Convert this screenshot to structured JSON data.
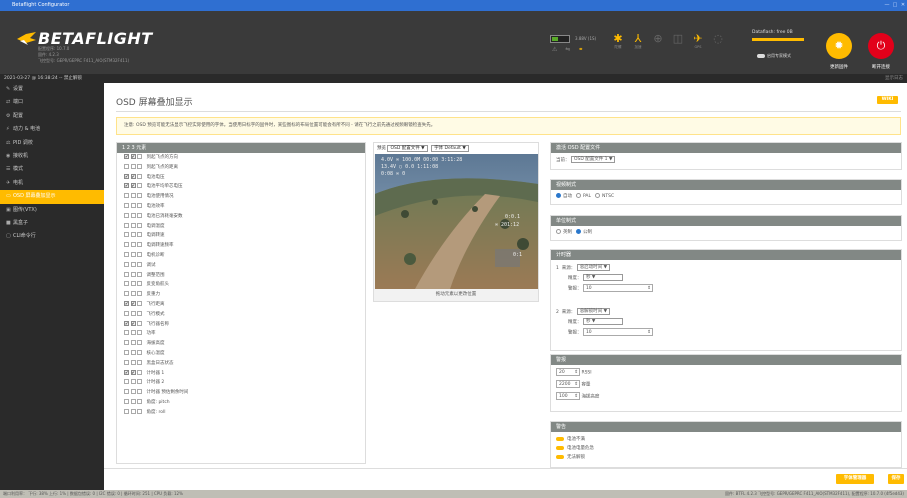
{
  "window": {
    "title": "Betaflight Configurator"
  },
  "header": {
    "brand": "BETAFLIGHT",
    "version_lines": [
      "配置程序: 10.7.0",
      "固件: 4.2.3",
      "飞控型号: GEPR/GEPRC F411_AIO(STM32F411)"
    ],
    "battery": "3.88V (1S)",
    "sensors": [
      {
        "name": "gyro-icon",
        "label": "陀螺"
      },
      {
        "name": "accel-icon",
        "label": "加速"
      },
      {
        "name": "mag-icon",
        "label": ""
      },
      {
        "name": "baro-icon",
        "label": ""
      },
      {
        "name": "gps-icon",
        "label": "GPS"
      },
      {
        "name": "sonar-icon",
        "label": ""
      }
    ],
    "dataflash": "Dataflash: free 0B",
    "dataflash_fill": 1.0,
    "expert_mode": "启用专家模式",
    "update_firmware": "更新固件",
    "disconnect": "断开连接"
  },
  "statusrow": {
    "left": "2021-03-27 @ 16:38:24 -- 禁止解锁",
    "right": "显示日志"
  },
  "sidebar": {
    "items": [
      {
        "icon": "wrench-icon",
        "glyph": "✎",
        "label": "设置"
      },
      {
        "icon": "ports-icon",
        "glyph": "⇄",
        "label": "端口"
      },
      {
        "icon": "config-icon",
        "glyph": "⚙",
        "label": "配置"
      },
      {
        "icon": "power-icon",
        "glyph": "⚡",
        "label": "动力 & 电池"
      },
      {
        "icon": "pid-icon",
        "glyph": "⚖",
        "label": "PID 调校"
      },
      {
        "icon": "receiver-icon",
        "glyph": "◉",
        "label": "接收机"
      },
      {
        "icon": "modes-icon",
        "glyph": "☰",
        "label": "模式"
      },
      {
        "icon": "motors-icon",
        "glyph": "✈",
        "label": "电机"
      },
      {
        "icon": "osd-icon",
        "glyph": "▭",
        "label": "OSD 屏幕叠加显示"
      },
      {
        "icon": "vtx-icon",
        "glyph": "▣",
        "label": "图传(VTX)"
      },
      {
        "icon": "blackbox-icon",
        "glyph": "■",
        "label": "黑盒子"
      },
      {
        "icon": "cli-icon",
        "glyph": "▢",
        "label": "CLI命令行"
      }
    ],
    "active_index": 8
  },
  "page": {
    "title": "OSD 屏幕叠加显示",
    "wiki": "WIKI",
    "notice": "注意: OSD 预览可能无法显示飞控实际使用的字体。当使用日标字的固件时，某些图标的布局位置可能会有所不同 - 请在飞行之前先通过视频眼镜检查失先。"
  },
  "elements": {
    "header": "1 2 3 元素",
    "items": [
      {
        "checks": [
          true,
          true,
          false
        ],
        "label": "到起飞点的方向"
      },
      {
        "checks": [
          false,
          false,
          false
        ],
        "label": "到起飞点的距离"
      },
      {
        "checks": [
          true,
          true,
          false
        ],
        "label": "电池电压"
      },
      {
        "checks": [
          true,
          true,
          false
        ],
        "label": "电池平均单芯电压"
      },
      {
        "checks": [
          false,
          false,
          false
        ],
        "label": "电池使用情况"
      },
      {
        "checks": [
          false,
          false,
          false
        ],
        "label": "电池效率"
      },
      {
        "checks": [
          false,
          false,
          false
        ],
        "label": "电池已消耗毫安数"
      },
      {
        "checks": [
          false,
          false,
          false
        ],
        "label": "电调温度"
      },
      {
        "checks": [
          false,
          false,
          false
        ],
        "label": "电调转速"
      },
      {
        "checks": [
          false,
          false,
          false
        ],
        "label": "电调转速频率"
      },
      {
        "checks": [
          false,
          false,
          false
        ],
        "label": "电机诊断"
      },
      {
        "checks": [
          false,
          false,
          false
        ],
        "label": "调试"
      },
      {
        "checks": [
          false,
          false,
          false
        ],
        "label": "调整范围"
      },
      {
        "checks": [
          false,
          false,
          false
        ],
        "label": "反变角航头"
      },
      {
        "checks": [
          false,
          false,
          false
        ],
        "label": "反重力"
      },
      {
        "checks": [
          true,
          true,
          false
        ],
        "label": "飞行距离"
      },
      {
        "checks": [
          false,
          false,
          false
        ],
        "label": "飞行模式"
      },
      {
        "checks": [
          true,
          true,
          false
        ],
        "label": "飞行器名称"
      },
      {
        "checks": [
          false,
          false,
          false
        ],
        "label": "功率"
      },
      {
        "checks": [
          false,
          false,
          false
        ],
        "label": "海拔高度"
      },
      {
        "checks": [
          false,
          false,
          false
        ],
        "label": "核心温度"
      },
      {
        "checks": [
          false,
          false,
          false
        ],
        "label": "黑盒日志状态"
      },
      {
        "checks": [
          true,
          true,
          false
        ],
        "label": "计时器 1"
      },
      {
        "checks": [
          false,
          false,
          false
        ],
        "label": "计时器 2"
      },
      {
        "checks": [
          false,
          false,
          false
        ],
        "label": "计时器 预估剩余时间"
      },
      {
        "checks": [
          false,
          false,
          false
        ],
        "label": "角度: pitch"
      },
      {
        "checks": [
          false,
          false,
          false
        ],
        "label": "角度: roll"
      }
    ]
  },
  "preview": {
    "label": "预览",
    "profile_select": "OSD 配置文件 ▼",
    "font_select": "字体 Default ▼",
    "caption": "拖动元素以更改位置",
    "osd_top1": "4.0V  ∞ 100.0M  00:00  3:11:28",
    "osd_top2": "13.4V  ○ 0.0  1:11:08",
    "osd_top3": "0:08  ∞ 0",
    "osd_right1": "0:0.1",
    "osd_right2": "∞ 201:12",
    "osd_right3": "0:1"
  },
  "profile_panel": {
    "title": "激活 OSD 配置文件",
    "label": "当前：",
    "value": "OSD 配置文件 1 ▼"
  },
  "video_panel": {
    "title": "视频制式",
    "options": [
      "自动",
      "PAL",
      "NTSC"
    ],
    "selected": 0
  },
  "units_panel": {
    "title": "单位制式",
    "options": [
      "英制",
      "公制"
    ],
    "selected": 1
  },
  "timers_panel": {
    "title": "计时器",
    "timers": [
      {
        "num": "1",
        "source_label": "来源：",
        "source": "总启动时间 ▼",
        "precision_label": "精度：",
        "precision": "秒 ▼",
        "alarm_label": "警报：",
        "alarm": "10"
      },
      {
        "num": "2",
        "source_label": "来源：",
        "source": "总解锁时间 ▼",
        "precision_label": "精度：",
        "precision": "秒 ▼",
        "alarm_label": "警报：",
        "alarm": "10"
      }
    ]
  },
  "alarms_panel": {
    "title": "警报",
    "rows": [
      {
        "value": "20",
        "label": "RSSI"
      },
      {
        "value": "2200",
        "label": "容量"
      },
      {
        "value": "100",
        "label": "海拔高度"
      }
    ]
  },
  "warnings_panel": {
    "title": "警告",
    "rows": [
      "电池不满",
      "电池电量危急",
      "无法解锁"
    ]
  },
  "footer": {
    "font_manager": "字体管理器",
    "save": "保存"
  },
  "statusbar": {
    "left": "端口利用率： 下行: 38% 上行: 1%  |  数据包错误: 0  |  I2C 错误: 0  |  循环时间: 251  |  CPU 负载: 12%",
    "right": "固件: BTFL 4.2.3 飞控型号: GEPR/GEPRC F411_AIO(STM32F411), 配置程序: 10.7.0 (4f5ed43)"
  },
  "colors": {
    "accent": "#ffbb00",
    "sidebar": "#2a2a2a",
    "header": "#3a3a3a",
    "panel_header": "#828885"
  }
}
